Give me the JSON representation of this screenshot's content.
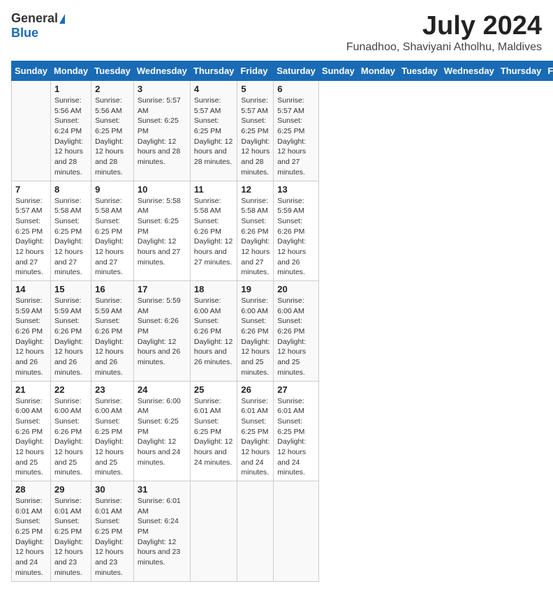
{
  "header": {
    "logo_general": "General",
    "logo_blue": "Blue",
    "month": "July 2024",
    "location": "Funadhoo, Shaviyani Atholhu, Maldives"
  },
  "days_of_week": [
    "Sunday",
    "Monday",
    "Tuesday",
    "Wednesday",
    "Thursday",
    "Friday",
    "Saturday"
  ],
  "weeks": [
    [
      {
        "day": "",
        "sunrise": "",
        "sunset": "",
        "daylight": ""
      },
      {
        "day": "1",
        "sunrise": "Sunrise: 5:56 AM",
        "sunset": "Sunset: 6:24 PM",
        "daylight": "Daylight: 12 hours and 28 minutes."
      },
      {
        "day": "2",
        "sunrise": "Sunrise: 5:56 AM",
        "sunset": "Sunset: 6:25 PM",
        "daylight": "Daylight: 12 hours and 28 minutes."
      },
      {
        "day": "3",
        "sunrise": "Sunrise: 5:57 AM",
        "sunset": "Sunset: 6:25 PM",
        "daylight": "Daylight: 12 hours and 28 minutes."
      },
      {
        "day": "4",
        "sunrise": "Sunrise: 5:57 AM",
        "sunset": "Sunset: 6:25 PM",
        "daylight": "Daylight: 12 hours and 28 minutes."
      },
      {
        "day": "5",
        "sunrise": "Sunrise: 5:57 AM",
        "sunset": "Sunset: 6:25 PM",
        "daylight": "Daylight: 12 hours and 28 minutes."
      },
      {
        "day": "6",
        "sunrise": "Sunrise: 5:57 AM",
        "sunset": "Sunset: 6:25 PM",
        "daylight": "Daylight: 12 hours and 27 minutes."
      }
    ],
    [
      {
        "day": "7",
        "sunrise": "Sunrise: 5:57 AM",
        "sunset": "Sunset: 6:25 PM",
        "daylight": "Daylight: 12 hours and 27 minutes."
      },
      {
        "day": "8",
        "sunrise": "Sunrise: 5:58 AM",
        "sunset": "Sunset: 6:25 PM",
        "daylight": "Daylight: 12 hours and 27 minutes."
      },
      {
        "day": "9",
        "sunrise": "Sunrise: 5:58 AM",
        "sunset": "Sunset: 6:25 PM",
        "daylight": "Daylight: 12 hours and 27 minutes."
      },
      {
        "day": "10",
        "sunrise": "Sunrise: 5:58 AM",
        "sunset": "Sunset: 6:25 PM",
        "daylight": "Daylight: 12 hours and 27 minutes."
      },
      {
        "day": "11",
        "sunrise": "Sunrise: 5:58 AM",
        "sunset": "Sunset: 6:26 PM",
        "daylight": "Daylight: 12 hours and 27 minutes."
      },
      {
        "day": "12",
        "sunrise": "Sunrise: 5:58 AM",
        "sunset": "Sunset: 6:26 PM",
        "daylight": "Daylight: 12 hours and 27 minutes."
      },
      {
        "day": "13",
        "sunrise": "Sunrise: 5:59 AM",
        "sunset": "Sunset: 6:26 PM",
        "daylight": "Daylight: 12 hours and 26 minutes."
      }
    ],
    [
      {
        "day": "14",
        "sunrise": "Sunrise: 5:59 AM",
        "sunset": "Sunset: 6:26 PM",
        "daylight": "Daylight: 12 hours and 26 minutes."
      },
      {
        "day": "15",
        "sunrise": "Sunrise: 5:59 AM",
        "sunset": "Sunset: 6:26 PM",
        "daylight": "Daylight: 12 hours and 26 minutes."
      },
      {
        "day": "16",
        "sunrise": "Sunrise: 5:59 AM",
        "sunset": "Sunset: 6:26 PM",
        "daylight": "Daylight: 12 hours and 26 minutes."
      },
      {
        "day": "17",
        "sunrise": "Sunrise: 5:59 AM",
        "sunset": "Sunset: 6:26 PM",
        "daylight": "Daylight: 12 hours and 26 minutes."
      },
      {
        "day": "18",
        "sunrise": "Sunrise: 6:00 AM",
        "sunset": "Sunset: 6:26 PM",
        "daylight": "Daylight: 12 hours and 26 minutes."
      },
      {
        "day": "19",
        "sunrise": "Sunrise: 6:00 AM",
        "sunset": "Sunset: 6:26 PM",
        "daylight": "Daylight: 12 hours and 25 minutes."
      },
      {
        "day": "20",
        "sunrise": "Sunrise: 6:00 AM",
        "sunset": "Sunset: 6:26 PM",
        "daylight": "Daylight: 12 hours and 25 minutes."
      }
    ],
    [
      {
        "day": "21",
        "sunrise": "Sunrise: 6:00 AM",
        "sunset": "Sunset: 6:26 PM",
        "daylight": "Daylight: 12 hours and 25 minutes."
      },
      {
        "day": "22",
        "sunrise": "Sunrise: 6:00 AM",
        "sunset": "Sunset: 6:26 PM",
        "daylight": "Daylight: 12 hours and 25 minutes."
      },
      {
        "day": "23",
        "sunrise": "Sunrise: 6:00 AM",
        "sunset": "Sunset: 6:25 PM",
        "daylight": "Daylight: 12 hours and 25 minutes."
      },
      {
        "day": "24",
        "sunrise": "Sunrise: 6:00 AM",
        "sunset": "Sunset: 6:25 PM",
        "daylight": "Daylight: 12 hours and 24 minutes."
      },
      {
        "day": "25",
        "sunrise": "Sunrise: 6:01 AM",
        "sunset": "Sunset: 6:25 PM",
        "daylight": "Daylight: 12 hours and 24 minutes."
      },
      {
        "day": "26",
        "sunrise": "Sunrise: 6:01 AM",
        "sunset": "Sunset: 6:25 PM",
        "daylight": "Daylight: 12 hours and 24 minutes."
      },
      {
        "day": "27",
        "sunrise": "Sunrise: 6:01 AM",
        "sunset": "Sunset: 6:25 PM",
        "daylight": "Daylight: 12 hours and 24 minutes."
      }
    ],
    [
      {
        "day": "28",
        "sunrise": "Sunrise: 6:01 AM",
        "sunset": "Sunset: 6:25 PM",
        "daylight": "Daylight: 12 hours and 24 minutes."
      },
      {
        "day": "29",
        "sunrise": "Sunrise: 6:01 AM",
        "sunset": "Sunset: 6:25 PM",
        "daylight": "Daylight: 12 hours and 23 minutes."
      },
      {
        "day": "30",
        "sunrise": "Sunrise: 6:01 AM",
        "sunset": "Sunset: 6:25 PM",
        "daylight": "Daylight: 12 hours and 23 minutes."
      },
      {
        "day": "31",
        "sunrise": "Sunrise: 6:01 AM",
        "sunset": "Sunset: 6:24 PM",
        "daylight": "Daylight: 12 hours and 23 minutes."
      },
      {
        "day": "",
        "sunrise": "",
        "sunset": "",
        "daylight": ""
      },
      {
        "day": "",
        "sunrise": "",
        "sunset": "",
        "daylight": ""
      },
      {
        "day": "",
        "sunrise": "",
        "sunset": "",
        "daylight": ""
      }
    ]
  ]
}
